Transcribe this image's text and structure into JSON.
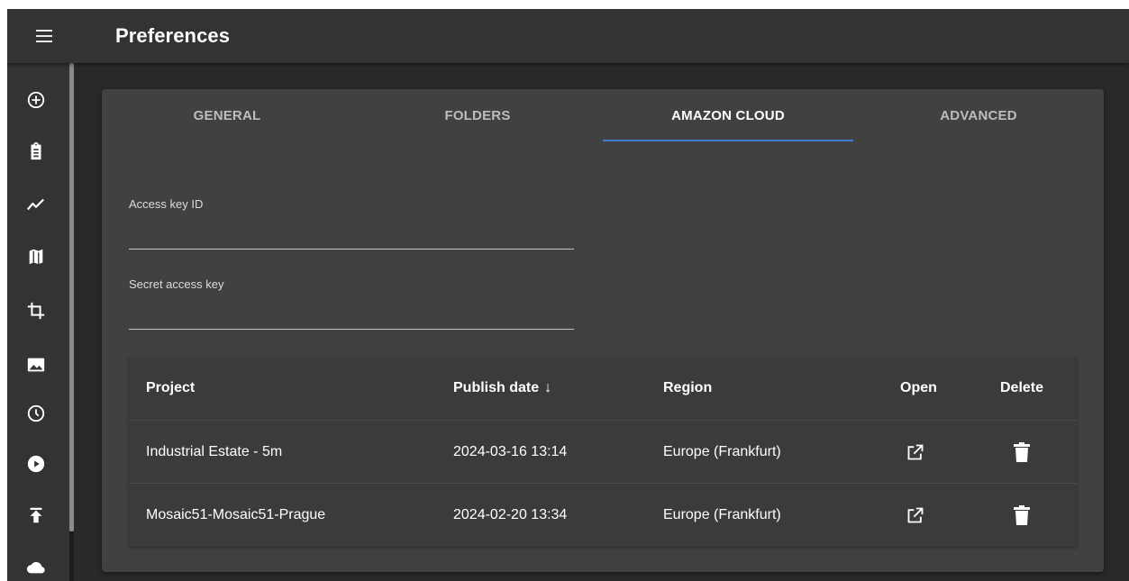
{
  "header": {
    "title": "Preferences",
    "menu_icon": "menu-icon"
  },
  "sidebar": {
    "items": [
      {
        "icon": "add-circle-icon"
      },
      {
        "icon": "clipboard-icon"
      },
      {
        "icon": "timeline-icon"
      },
      {
        "icon": "map-icon"
      },
      {
        "icon": "crop-icon"
      },
      {
        "icon": "image-icon"
      },
      {
        "icon": "clock-icon"
      },
      {
        "icon": "play-circle-icon"
      },
      {
        "icon": "publish-icon"
      },
      {
        "icon": "cloud-icon"
      }
    ]
  },
  "tabs": [
    {
      "label": "GENERAL",
      "active": false
    },
    {
      "label": "FOLDERS",
      "active": false
    },
    {
      "label": "AMAZON CLOUD",
      "active": true
    },
    {
      "label": "ADVANCED",
      "active": false
    }
  ],
  "form": {
    "access_key_label": "Access key ID",
    "access_key_value": "",
    "secret_key_label": "Secret access key",
    "secret_key_value": ""
  },
  "table": {
    "columns": {
      "project": "Project",
      "publish_date": "Publish date",
      "sort_arrow": "↓",
      "region": "Region",
      "open": "Open",
      "delete": "Delete"
    },
    "rows": [
      {
        "project": "Industrial Estate - 5m",
        "publish_date": "2024-03-16 13:14",
        "region": "Europe (Frankfurt)"
      },
      {
        "project": "Mosaic51-Mosaic51-Prague",
        "publish_date": "2024-02-20 13:34",
        "region": "Europe (Frankfurt)"
      }
    ]
  },
  "colors": {
    "accent": "#3f7dd1",
    "background": "#292929",
    "card": "#414141",
    "bar": "#333333"
  }
}
